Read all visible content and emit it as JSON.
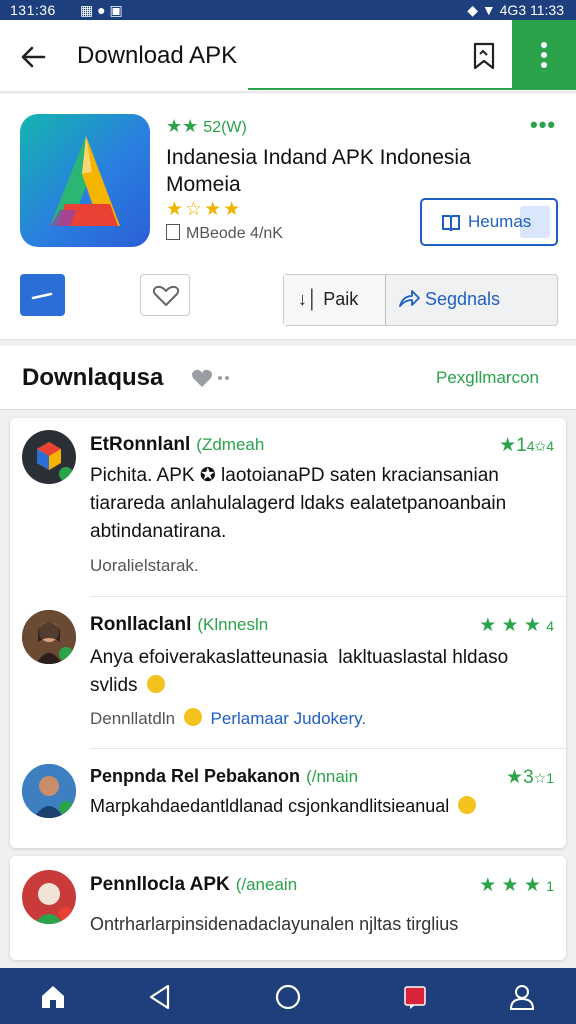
{
  "status_bar": {
    "time_left": "131:36",
    "time_right": "11:33",
    "signal_text": "4G3"
  },
  "app_bar": {
    "title": "Download APK"
  },
  "app": {
    "top_rating_stars": "★★",
    "top_rating_value": "52(W)",
    "name": "Indanesia Indand APK Indonesia Momeia",
    "rating_stars": "★☆★★",
    "meta": "MBeode 4/nK",
    "secondary_button": "Heumas"
  },
  "actions": {
    "segment_left": "Paik",
    "segment_right": "Segdnals"
  },
  "section": {
    "title": "Downlaqusa",
    "link": "Pexgllmarcon"
  },
  "reviews": [
    {
      "name": "EtRonnlanl",
      "tag": "(Zdmeah",
      "rating": "★1",
      "rating_n": "4✩4",
      "body": "Pichita. APK ✪ laotoianaPD saten kraciansanian tiarareda anlahulalagerd ldaks ealatetpanoanbain abtindanatirana.",
      "footer": "Uoralielstarak."
    },
    {
      "name": "Ronllaclanl",
      "tag": "(Klnnesln",
      "rating": "★ ★ ★",
      "rating_n": "4",
      "body": "Anya efoiverakaslatteunasia ⁠ lakltuaslastal hldaso svlids",
      "footer": "Dennllatdln",
      "footer_link": "Perlamaar Judokery."
    },
    {
      "name": "Penpnda Rel Pebakanon",
      "tag": "(/nnain",
      "rating": "★3",
      "rating_n": "☆1",
      "body": "Marpkahdaedantldlanad csjonkandlitsieanual"
    },
    {
      "name": "Pennllocla APK",
      "tag": "(/aneain",
      "rating": "★ ★ ★",
      "rating_n": "1",
      "body": "Ontrharlarpinsidenadaclayunalen njltas tirglius"
    }
  ],
  "nav": {
    "items": [
      "home-icon",
      "back-icon",
      "circle-icon",
      "recent-icon",
      "profile-icon"
    ]
  },
  "colors": {
    "green": "#2aa34a",
    "blue": "#1f5fc4",
    "nav": "#1e3f7c"
  }
}
